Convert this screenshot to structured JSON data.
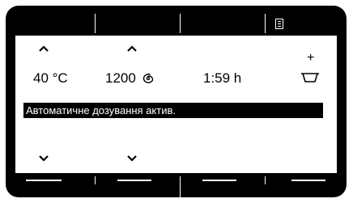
{
  "display": {
    "temperature": "40 °C",
    "spin_speed": "1200",
    "spin_icon": "spin-spiral-icon",
    "duration": "1:59 h",
    "plus_label": "+",
    "basin_icon": "detergent-basin-icon",
    "menu_icon": "menu-list-icon",
    "status_message": "Автоматичне дозування актив."
  },
  "colors": {
    "bezel": "#000000",
    "screen": "#ffffff",
    "text": "#000000"
  }
}
